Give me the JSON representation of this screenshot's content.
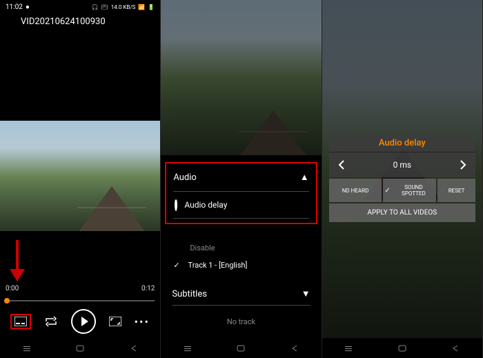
{
  "status": {
    "time": "11:02",
    "net_label": "14.0 KB/S"
  },
  "video": {
    "title": "VID20210624100930",
    "current_time": "0:00",
    "duration": "0:12"
  },
  "panel2": {
    "audio_header": "Audio",
    "audio_delay": "Audio delay",
    "disable": "Disable",
    "track1": "Track 1 - [English]",
    "subtitles_header": "Subtitles",
    "no_track": "No track"
  },
  "panel3": {
    "title": "Audio delay",
    "value": "0 ms",
    "sound_heard": "ND HEARD",
    "sound_spotted": "SOUND SPOTTED",
    "reset": "RESET",
    "apply": "APPLY TO ALL VIDEOS"
  }
}
